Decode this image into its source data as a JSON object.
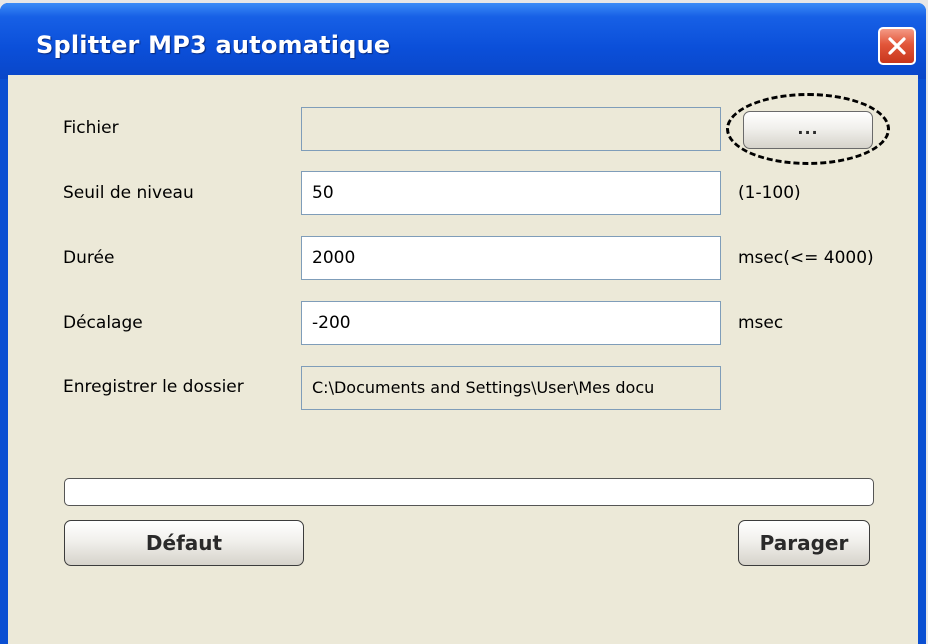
{
  "window": {
    "title": "Splitter MP3 automatique",
    "close_icon": "close-icon"
  },
  "form": {
    "file_label": "Fichier",
    "file_value": "",
    "browse_label": "...",
    "threshold_label": "Seuil de niveau",
    "threshold_value": "50",
    "threshold_hint": "(1-100)",
    "duration_label": "Durée",
    "duration_value": "2000",
    "duration_hint": "msec(<= 4000)",
    "offset_label": "Décalage",
    "offset_value": "-200",
    "offset_hint": "msec",
    "folder_label": "Enregistrer le dossier",
    "folder_value": "C:\\Documents and Settings\\User\\Mes docu"
  },
  "progress": {
    "value": 0
  },
  "buttons": {
    "default_label": "Défaut",
    "split_label": "Parager"
  },
  "colors": {
    "titlebar": "#0a4fd2",
    "client_bg": "#ece9d8",
    "close_red": "#e2563a"
  }
}
